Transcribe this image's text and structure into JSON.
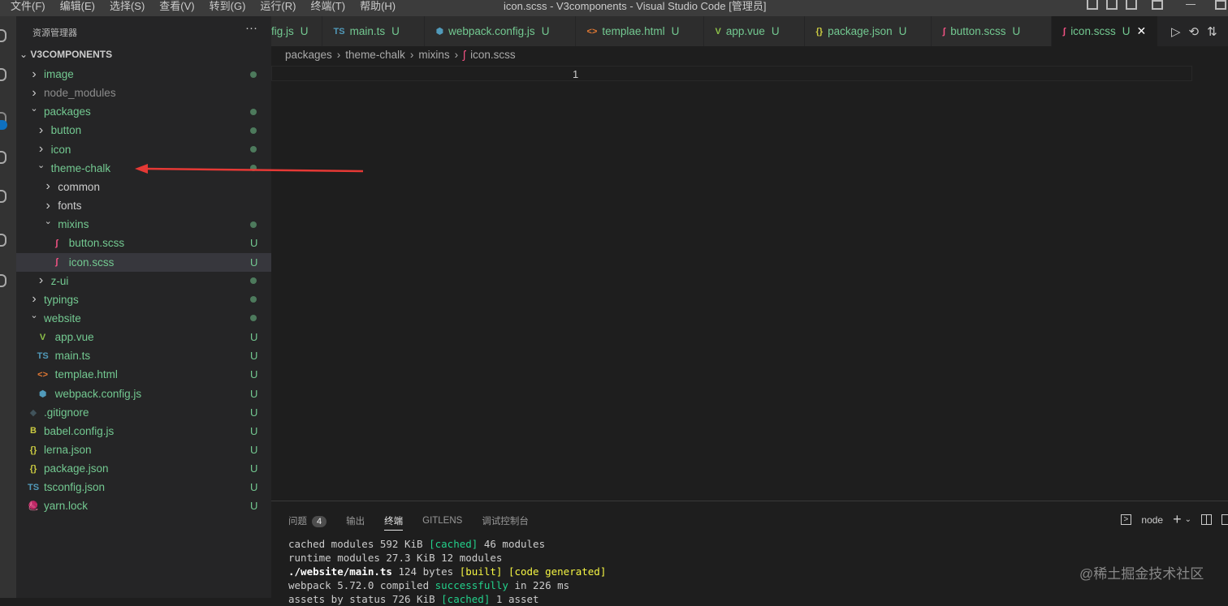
{
  "menu": [
    "文件(F)",
    "编辑(E)",
    "选择(S)",
    "查看(V)",
    "转到(G)",
    "运行(R)",
    "终端(T)",
    "帮助(H)"
  ],
  "window_title": "icon.scss - V3components - Visual Studio Code [管理员]",
  "sidebar": {
    "title": "资源管理器",
    "more": "···",
    "root": "V3COMPONENTS",
    "items": [
      {
        "label": "image",
        "depth": 0,
        "kind": "closed",
        "status": "dot"
      },
      {
        "label": "node_modules",
        "depth": 0,
        "kind": "closed",
        "status": "",
        "muted": true
      },
      {
        "label": "packages",
        "depth": 0,
        "kind": "open",
        "status": "dot"
      },
      {
        "label": "button",
        "depth": 1,
        "kind": "closed",
        "status": "dot"
      },
      {
        "label": "icon",
        "depth": 1,
        "kind": "closed",
        "status": "dot"
      },
      {
        "label": "theme-chalk",
        "depth": 1,
        "kind": "open",
        "status": "dot"
      },
      {
        "label": "common",
        "depth": 2,
        "kind": "closed",
        "status": "",
        "plain": true
      },
      {
        "label": "fonts",
        "depth": 2,
        "kind": "closed",
        "status": "",
        "plain": true
      },
      {
        "label": "mixins",
        "depth": 2,
        "kind": "open",
        "status": "dot"
      },
      {
        "label": "button.scss",
        "depth": 3,
        "kind": "file",
        "icon": "sass",
        "status": "U"
      },
      {
        "label": "icon.scss",
        "depth": 3,
        "kind": "file",
        "icon": "sass",
        "status": "U",
        "selected": true
      },
      {
        "label": "z-ui",
        "depth": 1,
        "kind": "closed",
        "status": "dot"
      },
      {
        "label": "typings",
        "depth": 0,
        "kind": "closed",
        "status": "dot"
      },
      {
        "label": "website",
        "depth": 0,
        "kind": "open",
        "status": "dot"
      },
      {
        "label": "app.vue",
        "depth": 1,
        "kind": "file",
        "icon": "vue",
        "status": "U"
      },
      {
        "label": "main.ts",
        "depth": 1,
        "kind": "file",
        "icon": "ts",
        "status": "U"
      },
      {
        "label": "templae.html",
        "depth": 1,
        "kind": "file",
        "icon": "html",
        "status": "U"
      },
      {
        "label": "webpack.config.js",
        "depth": 1,
        "kind": "file",
        "icon": "webpack",
        "status": "U"
      },
      {
        "label": ".gitignore",
        "depth": 0,
        "kind": "file",
        "icon": "git",
        "status": "U"
      },
      {
        "label": "babel.config.js",
        "depth": 0,
        "kind": "file",
        "icon": "babel",
        "status": "U"
      },
      {
        "label": "lerna.json",
        "depth": 0,
        "kind": "file",
        "icon": "json",
        "status": "U"
      },
      {
        "label": "package.json",
        "depth": 0,
        "kind": "file",
        "icon": "json",
        "status": "U"
      },
      {
        "label": "tsconfig.json",
        "depth": 0,
        "kind": "file",
        "icon": "tsconfig",
        "status": "U"
      },
      {
        "label": "yarn.lock",
        "depth": 0,
        "kind": "file",
        "icon": "yarn",
        "status": "U"
      }
    ]
  },
  "tabs": [
    {
      "label": "ﬁg.js",
      "icon": "",
      "status": "U"
    },
    {
      "label": "main.ts",
      "icon": "ts",
      "status": "U"
    },
    {
      "label": "webpack.config.js",
      "icon": "webpack",
      "status": "U"
    },
    {
      "label": "templae.html",
      "icon": "html",
      "status": "U"
    },
    {
      "label": "app.vue",
      "icon": "vue",
      "status": "U"
    },
    {
      "label": "package.json",
      "icon": "json",
      "status": "U"
    },
    {
      "label": "button.scss",
      "icon": "sass",
      "status": "U"
    },
    {
      "label": "icon.scss",
      "icon": "sass",
      "status": "U",
      "active": true
    }
  ],
  "icons": {
    "sass": {
      "glyph": "ʃ",
      "color": "#f55385"
    },
    "ts": {
      "glyph": "TS",
      "color": "#519aba"
    },
    "webpack": {
      "glyph": "⬢",
      "color": "#519aba"
    },
    "html": {
      "glyph": "<>",
      "color": "#e37933"
    },
    "vue": {
      "glyph": "V",
      "color": "#8dc149"
    },
    "json": {
      "glyph": "{}",
      "color": "#cbcb41"
    },
    "git": {
      "glyph": "◆",
      "color": "#41535b"
    },
    "babel": {
      "glyph": "B",
      "color": "#cbcb41"
    },
    "tsconfig": {
      "glyph": "TS",
      "color": "#519aba"
    },
    "yarn": {
      "glyph": "🧶",
      "color": "#519aba"
    }
  },
  "breadcrumb": [
    "packages",
    "theme-chalk",
    "mixins",
    "icon.scss"
  ],
  "editor": {
    "line_number": "1"
  },
  "panel": {
    "tabs": [
      "问题",
      "输出",
      "终端",
      "GITLENS",
      "调试控制台"
    ],
    "active_tab": "终端",
    "problems_count": "4",
    "terminal_name": "node",
    "terminal_lines": [
      [
        {
          "t": "cached modules 592 KiB "
        },
        {
          "t": "[cached]",
          "c": "g"
        },
        {
          "t": " 46 modules"
        }
      ],
      [
        {
          "t": "runtime modules 27.3 KiB 12 modules"
        }
      ],
      [
        {
          "t": "./website/main.ts",
          "c": "b"
        },
        {
          "t": " 124 bytes "
        },
        {
          "t": "[built] [code generated]",
          "c": "y"
        }
      ],
      [
        {
          "t": "webpack 5.72.0 compiled "
        },
        {
          "t": "successfully",
          "c": "g"
        },
        {
          "t": " in 226 ms"
        }
      ],
      [
        {
          "t": "assets by status 726 KiB "
        },
        {
          "t": "[cached]",
          "c": "g"
        },
        {
          "t": " 1 asset"
        }
      ]
    ]
  },
  "watermark": "@稀土掘金技术社区",
  "colors": {
    "untracked": "#73c991",
    "annotation_arrow": "#e53935"
  }
}
